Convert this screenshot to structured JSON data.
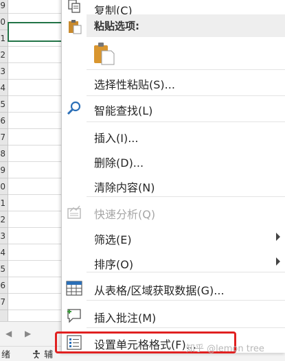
{
  "sheet": {
    "row_labels": [
      "9",
      "0",
      "1",
      "2",
      "3",
      "4",
      "5",
      "6",
      "7",
      "8",
      "9",
      "0",
      "1",
      "2",
      "3",
      "4",
      "5",
      "6",
      "7"
    ],
    "status_left": "绪",
    "status_right": "辅"
  },
  "menu": {
    "copy": "复制(C)",
    "paste_options": "粘贴选项:",
    "paste_special": "选择性粘贴(S)...",
    "smart_lookup": "智能查找(L)",
    "insert": "插入(I)...",
    "delete": "删除(D)...",
    "clear_contents": "清除内容(N)",
    "quick_analysis": "快速分析(Q)",
    "filter": "筛选(E)",
    "sort": "排序(O)",
    "get_data": "从表格/区域获取数据(G)...",
    "insert_comment": "插入批注(M)",
    "format_cells": "设置单元格格式(F)..."
  },
  "watermark": "知乎 @lemon tree",
  "colors": {
    "accent_green": "#217346",
    "highlight_red": "#e02020",
    "icon_blue": "#2b6fb7"
  }
}
